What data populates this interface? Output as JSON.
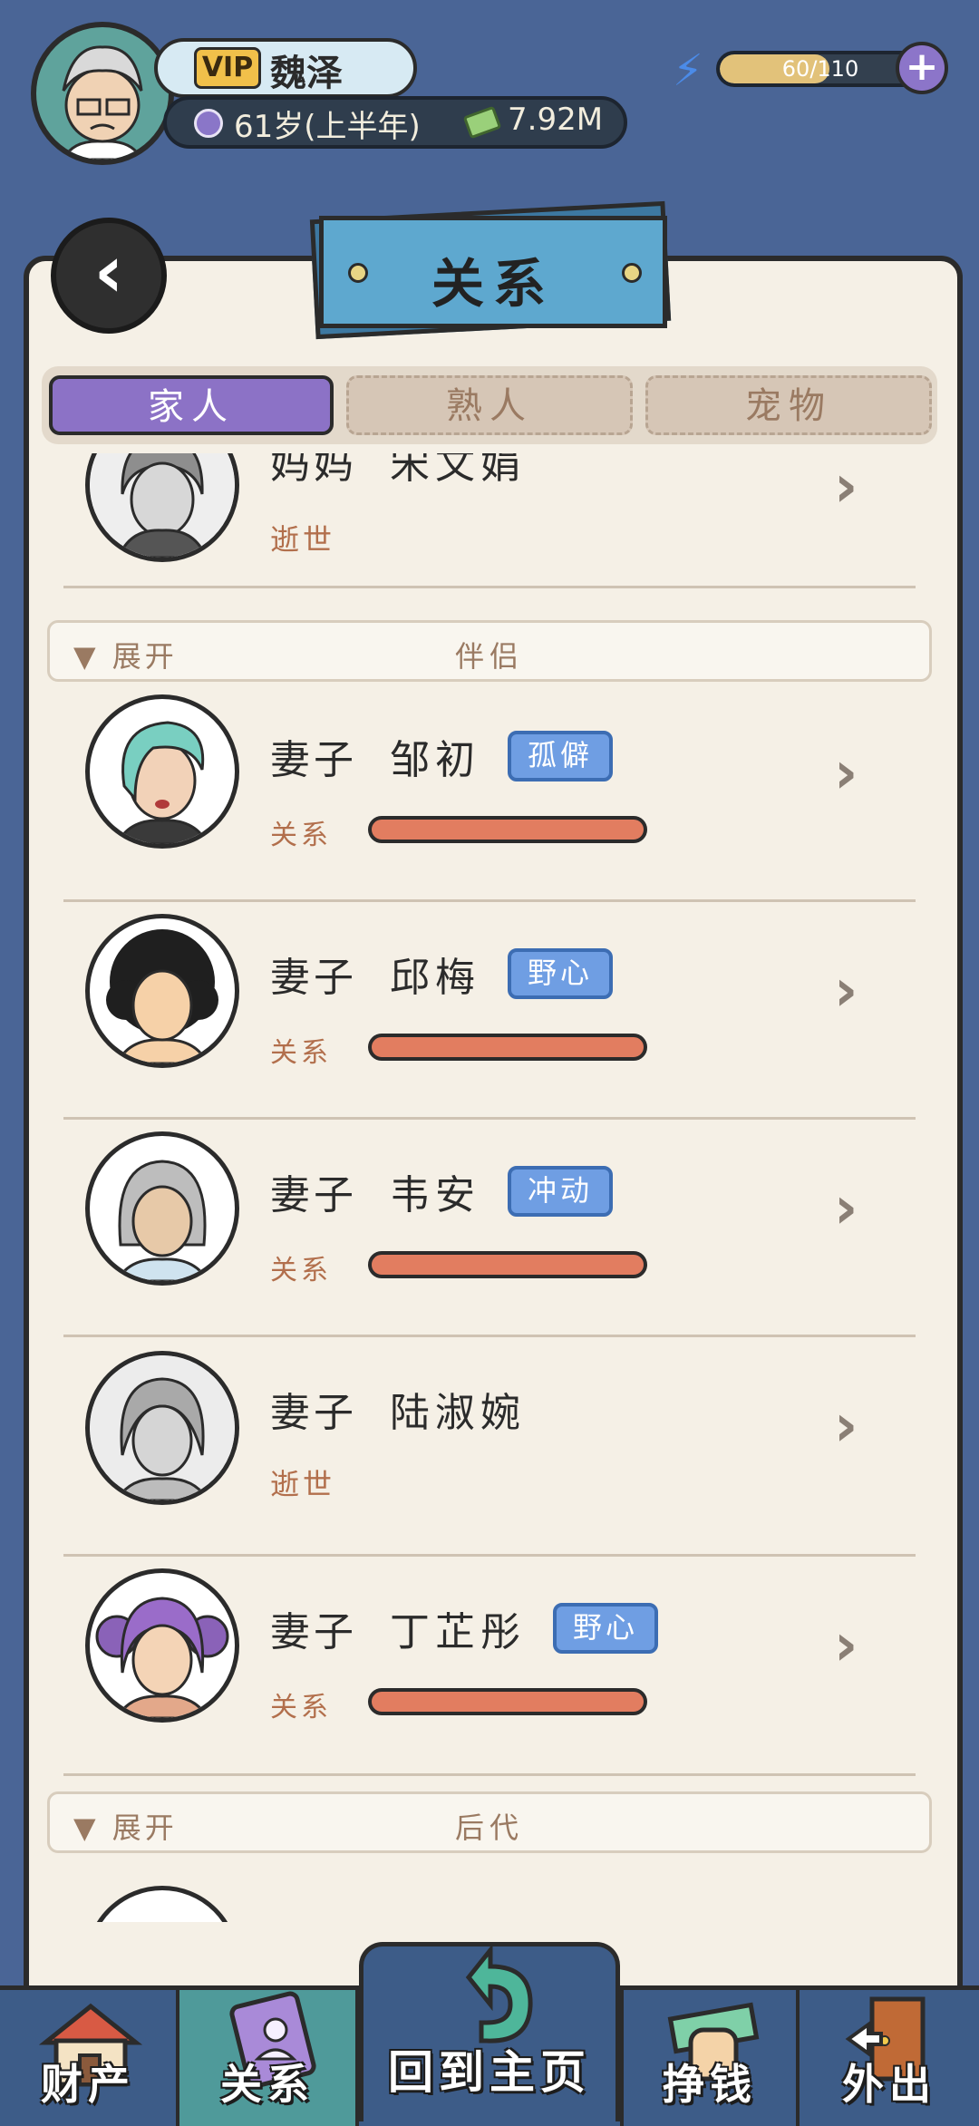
{
  "player": {
    "vip": "VIP",
    "name": "魏泽",
    "age": "61岁(上半年)",
    "money": "7.92M",
    "energy": {
      "text": "60/110",
      "fraction": 0.545
    }
  },
  "page": {
    "title": "关系"
  },
  "tabs": [
    {
      "label": "家人",
      "active": true
    },
    {
      "label": "熟人",
      "active": false
    },
    {
      "label": "宠物",
      "active": false
    }
  ],
  "sections": {
    "partner": {
      "toggle": "▼ 展开",
      "title": "伴侣"
    },
    "offspring": {
      "toggle": "▼ 展开",
      "title": "后代"
    }
  },
  "rows": [
    {
      "role": "妈妈",
      "name": "宋文娟",
      "status": "逝世"
    },
    {
      "role": "妻子",
      "name": "邹初",
      "trait": "孤僻",
      "rel_label": "关系"
    },
    {
      "role": "妻子",
      "name": "邱梅",
      "trait": "野心",
      "rel_label": "关系"
    },
    {
      "role": "妻子",
      "name": "韦安",
      "trait": "冲动",
      "rel_label": "关系"
    },
    {
      "role": "妻子",
      "name": "陆淑婉",
      "status": "逝世"
    },
    {
      "role": "妻子",
      "name": "丁芷彤",
      "trait": "野心",
      "rel_label": "关系"
    }
  ],
  "nav": {
    "assets": "财产",
    "relations": "关系",
    "home": "回到主页",
    "earn": "挣钱",
    "outing": "外出"
  },
  "colors": {
    "accent_purple": "#8c72c6",
    "trait_blue": "#6f9ee3",
    "relation_bar": "#e27d60",
    "paper": "#f5f0e6",
    "background": "#4a6596"
  }
}
